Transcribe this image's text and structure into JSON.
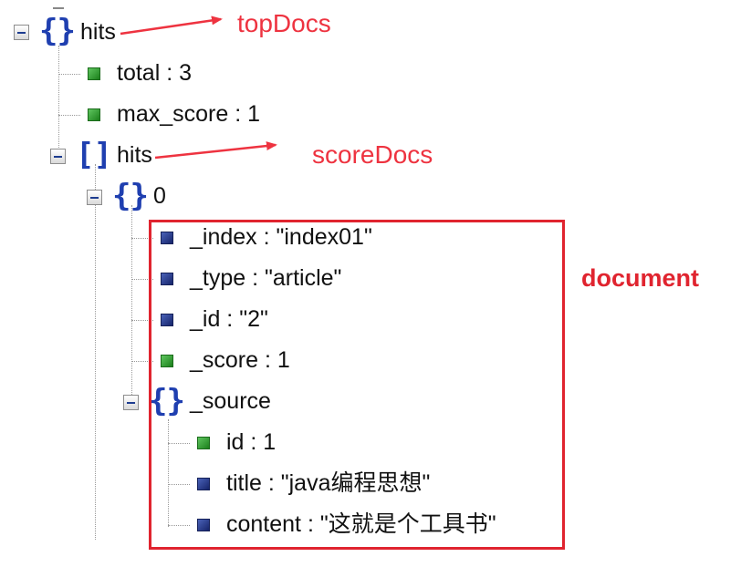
{
  "tree": {
    "root_key": "hits",
    "total_label": "total : 3",
    "max_score_label": "max_score : 1",
    "hits_key": "hits",
    "index_0": "0",
    "index_label": "_index : \"index01\"",
    "type_label": "_type : \"article\"",
    "id_label": "_id : \"2\"",
    "score_label": "_score : 1",
    "source_key": "_source",
    "source_id_label": "id : 1",
    "source_title_label": "title : \"java编程思想\"",
    "source_content_label": "content : \"这就是个工具书\""
  },
  "brackets": {
    "object": "{}",
    "array": "[]"
  },
  "annotations": {
    "topdocs": "topDocs",
    "scoredocs": "scoreDocs",
    "document": "document"
  },
  "icons": {
    "expanded": "collapse-minus-icon",
    "leaf_number": "green-square-icon",
    "leaf_string": "blue-square-icon"
  },
  "colors": {
    "annotation_red": "#e0242f",
    "brace_blue": "#1f3fb0",
    "leaf_green": "#2e9a2e",
    "leaf_blue": "#1e2f80"
  }
}
